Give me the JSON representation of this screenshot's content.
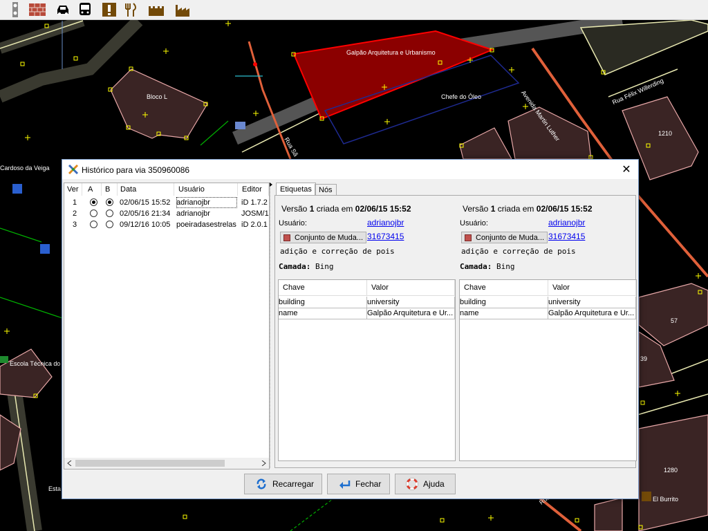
{
  "toolbar": {
    "icons": [
      "traffic-signal-icon",
      "brick-wall-icon",
      "car-icon",
      "bus-icon",
      "exclamation-icon",
      "restaurant-icon",
      "castle-icon",
      "factory-icon"
    ]
  },
  "map": {
    "labels": {
      "galpao": "Galpão Arquitetura e Urbanismo",
      "bloco_l": "Bloco L",
      "chefe": "Chefe do Óleo",
      "av_martin": "Avenida Martin Luther",
      "rua_felix": "Rua Félix Willerding",
      "rua_sa": "Rua Sã",
      "cardoso": "Cardoso da Veiga",
      "b1210": "1210",
      "b57": "57",
      "b39": "39",
      "b1280": "1280",
      "escola": "Escola Técnica do",
      "esta": "Esta",
      "rua_sao_paulo": "Rua São Paulo",
      "el_burrito": "El Burrito"
    }
  },
  "dialog": {
    "title": "Histórico para via 350960086",
    "close_label": "✕",
    "history": {
      "headers": {
        "ver": "Ver",
        "a": "A",
        "b": "B",
        "data": "Data",
        "usuario": "Usuário",
        "editor": "Editor"
      },
      "rows": [
        {
          "ver": "1",
          "a": true,
          "b": true,
          "data": "02/06/15 15:52",
          "usuario": "adrianojbr",
          "editor": "iD 1.7.2"
        },
        {
          "ver": "2",
          "a": false,
          "b": false,
          "data": "02/05/16 21:34",
          "usuario": "adrianojbr",
          "editor": "JOSM/1."
        },
        {
          "ver": "3",
          "a": false,
          "b": false,
          "data": "09/12/16 10:05",
          "usuario": "poeiradasestrelas",
          "editor": "iD 2.0.1"
        }
      ]
    },
    "tabs": [
      "Etiquetas",
      "Nós"
    ],
    "left_version": {
      "title_prefix": "Versão",
      "version": "1",
      "title_mid": "criada em",
      "date": "02/06/15 15:52",
      "user_label": "Usuário:",
      "user": "adrianojbr",
      "changeset_button": "Conjunto de Muda...",
      "changeset_id": "31673415",
      "comment": "adição e correção de pois",
      "source_label": "Camada:",
      "source_value": "Bing",
      "tag_headers": {
        "key": "Chave",
        "value": "Valor"
      },
      "tags": [
        {
          "key": "building",
          "value": "university"
        },
        {
          "key": "name",
          "value": "Galpão Arquitetura e Ur..."
        }
      ]
    },
    "right_version": {
      "title_prefix": "Versão",
      "version": "1",
      "title_mid": "criada em",
      "date": "02/06/15 15:52",
      "user_label": "Usuário:",
      "user": "adrianojbr",
      "changeset_button": "Conjunto de Muda...",
      "changeset_id": "31673415",
      "comment": "adição e correção de pois",
      "source_label": "Camada:",
      "source_value": "Bing",
      "tag_headers": {
        "key": "Chave",
        "value": "Valor"
      },
      "tags": [
        {
          "key": "building",
          "value": "university"
        },
        {
          "key": "name",
          "value": "Galpão Arquitetura e Ur..."
        }
      ]
    },
    "buttons": {
      "reload": "Recarregar",
      "close": "Fechar",
      "help": "Ajuda"
    }
  }
}
